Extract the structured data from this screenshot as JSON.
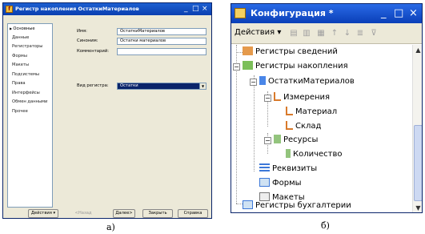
{
  "window_a": {
    "title": "Регистр накопления ОстаткиМатериалов",
    "controls": {
      "minimize": "_",
      "maximize": "□",
      "close": "×"
    },
    "sidebar_items": [
      {
        "label": "Основные"
      },
      {
        "label": "Данные"
      },
      {
        "label": "Регистраторы"
      },
      {
        "label": "Формы"
      },
      {
        "label": "Макеты"
      },
      {
        "label": "Подсистемы"
      },
      {
        "label": "Права"
      },
      {
        "label": "Интерфейсы"
      },
      {
        "label": "Обмен данными"
      },
      {
        "label": "Прочее"
      }
    ],
    "fields": {
      "name_label": "Имя:",
      "name_value": "ОстаткиМатериалов",
      "synonym_label": "Синоним:",
      "synonym_value": "Остатки материалов",
      "comment_label": "Комментарий:",
      "comment_value": "",
      "register_type_label": "Вид регистра:",
      "register_type_value": "Остатки"
    },
    "buttons": {
      "actions": "Действия ▾",
      "back": "<Назад",
      "next": "Далее>",
      "close": "Закрыть",
      "help": "Справка"
    }
  },
  "window_b": {
    "title": "Конфигурация *",
    "controls": {
      "minimize": "_",
      "maximize": "□",
      "close": "×"
    },
    "toolbar": {
      "actions_label": "Действия ▾"
    },
    "tree": [
      {
        "label": "Регистры сведений",
        "icon": "info-register-icon",
        "color": "#d97a2b"
      },
      {
        "label": "Регистры накопления",
        "icon": "accumulation-register-icon",
        "color": "#6aa84f"
      },
      {
        "label": "ОстаткиМатериалов",
        "icon": "register-item-icon",
        "color": "#3c78d8"
      },
      {
        "label": "Измерения",
        "icon": "dimensions-icon",
        "color": "#d97a2b"
      },
      {
        "label": "Материал",
        "icon": "dimension-item-icon",
        "color": "#d97a2b"
      },
      {
        "label": "Склад",
        "icon": "dimension-item-icon",
        "color": "#d97a2b"
      },
      {
        "label": "Ресурсы",
        "icon": "resources-icon",
        "color": "#6aa84f"
      },
      {
        "label": "Количество",
        "icon": "resource-item-icon",
        "color": "#6aa84f"
      },
      {
        "label": "Реквизиты",
        "icon": "attributes-icon",
        "color": "#3c78d8"
      },
      {
        "label": "Формы",
        "icon": "forms-icon",
        "color": "#3c78d8"
      },
      {
        "label": "Макеты",
        "icon": "templates-icon",
        "color": "#777777"
      },
      {
        "label": "Регистры бухгалтерии",
        "icon": "accounting-register-icon",
        "color": "#3c78d8"
      }
    ]
  },
  "captions": {
    "a": "а)",
    "b": "б)"
  }
}
